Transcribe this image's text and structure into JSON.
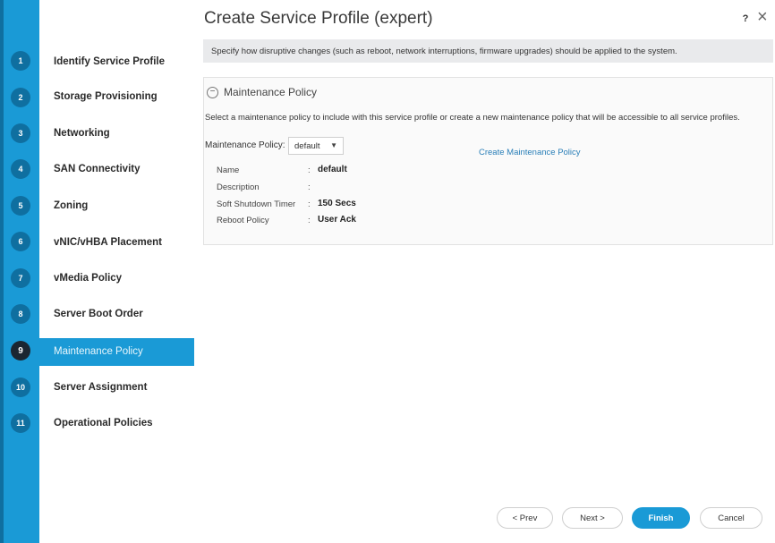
{
  "window": {
    "title": "Create Service Profile (expert)",
    "help_label": "?",
    "close_label": "×"
  },
  "banner": {
    "text": "Specify how disruptive changes (such as reboot, network interruptions, firmware upgrades) should be applied to the system."
  },
  "steps": [
    {
      "number": "1",
      "label": "Identify Service Profile"
    },
    {
      "number": "2",
      "label": "Storage Provisioning"
    },
    {
      "number": "3",
      "label": "Networking"
    },
    {
      "number": "4",
      "label": "SAN Connectivity"
    },
    {
      "number": "5",
      "label": "Zoning"
    },
    {
      "number": "6",
      "label": "vNIC/vHBA Placement"
    },
    {
      "number": "7",
      "label": "vMedia Policy"
    },
    {
      "number": "8",
      "label": "Server Boot Order"
    },
    {
      "number": "9",
      "label": "Maintenance Policy"
    },
    {
      "number": "10",
      "label": "Server Assignment"
    },
    {
      "number": "11",
      "label": "Operational Policies"
    }
  ],
  "active_step": "9",
  "panel": {
    "header": "Maintenance Policy",
    "collapse_icon": "−",
    "description": "Select a maintenance policy to include with this service profile or create a new maintenance policy that will be accessible to all service profiles.",
    "policy_label": "Maintenance Policy:",
    "policy_value": "default",
    "dropdown_icon": "▼",
    "create_link": "Create Maintenance Policy",
    "details": [
      {
        "key": "Name",
        "sep": ":",
        "value": "default"
      },
      {
        "key": "Description",
        "sep": ":",
        "value": ""
      },
      {
        "key": "Soft Shutdown Timer",
        "sep": ":",
        "value": "150 Secs"
      },
      {
        "key": "Reboot Policy",
        "sep": ":",
        "value": "User Ack"
      }
    ]
  },
  "buttons": {
    "prev": "< Prev",
    "next": "Next >",
    "finish": "Finish",
    "cancel": "Cancel"
  },
  "colors": {
    "accent": "#1a9ad6",
    "badge": "#0f6fa0",
    "active_badge": "#1b2631",
    "link": "#2a7fb8"
  }
}
